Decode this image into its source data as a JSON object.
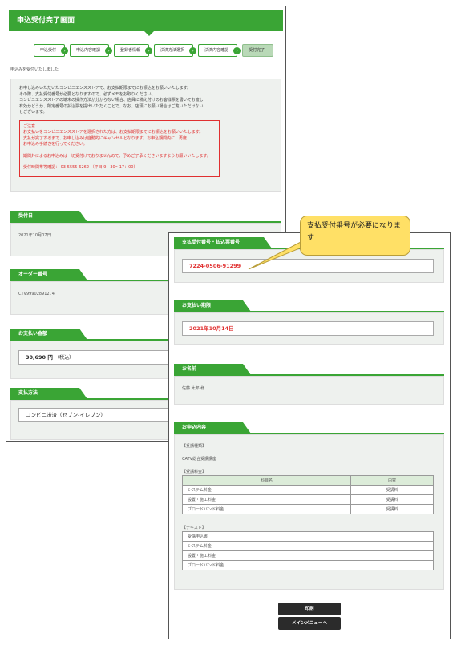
{
  "back": {
    "header_title": "申込受付完了画面",
    "steps": [
      "申込受付",
      "申込内容確認",
      "登録者情報",
      "決済方法選択",
      "決済内容確認",
      "受付完了"
    ],
    "received_note": "申込みを受付いたしました",
    "info_text": "お申し込みいただいたコンビニエンスストアで、お支払期限までにお振込をお願いいたします。\nその際、支払受付番号が必要となりますので、必ずメモをお取りください。\nコンビニエンスストアの端末の操作方法が分からない場合、店員に備え付けのお客様票を書いてお渡し\n有効かどうか、所定番号の払込票を提出いただくことで、なお、店頭にお願い場合はご覧いただけない\nとございます。",
    "alert_title": "ご注意",
    "alert_text1": "お支払いをコンビニエンスストアを選択された方は、お支払期限までにお振込をお願いいたします。\n支払が完了するまで、お申し込みは自動的にキャンセルとなります。お申込期間内に、再度\nお申込み手続きを行ってください。",
    "alert_text2": "期間外によるお申込みは一切受付けておりませんので、予めご了承くださいますようお願いいたします。",
    "alert_text3": "受付時間帯等確認： 03-5555-6262 （平日 9：30～17：00）",
    "sections": {
      "date_label": "受付日",
      "date_value": "2021年10月07日",
      "order_label": "オーダー番号",
      "order_value": "CTV99902891274",
      "amount_label": "お支払い金額",
      "amount_value": "30,690 円",
      "amount_tax": "（税込）",
      "method_label": "支払方法",
      "method_value": "コンビニ決済（セブン-イレブン）"
    }
  },
  "front": {
    "payment_number_label": "支払受付番号・払込票番号",
    "payment_number_value": "7224-0506-91299",
    "deadline_label": "お支払い期限",
    "deadline_value": "2021年10月14日",
    "name_label": "お名前",
    "name_value": "佐藤 太郎 様",
    "details_label": "お申込内容",
    "service_tag": "【受講種類】",
    "service_value": "CATV総合受講講座",
    "fee_tag": "【受講料金】",
    "table_headers": [
      "科目名",
      "内容"
    ],
    "table_rows": [
      [
        "システム料金",
        "受講料"
      ],
      [
        "設置・施工料金",
        "受講料"
      ],
      [
        "ブロードバンド料金",
        "受講料"
      ]
    ],
    "text_tag": "【テキスト】",
    "text_rows": [
      "受講申込書",
      "システム料金",
      "設置・施工料金",
      "ブロードバンド料金"
    ],
    "print_button": "印刷",
    "menu_button": "メインメニューへ"
  },
  "callout": {
    "text": "支払受付番号が必要になります"
  },
  "colors": {
    "accent": "#3aa535",
    "panel": "#eef1ee",
    "alert": "#e03030",
    "callout": "#ffe066"
  }
}
